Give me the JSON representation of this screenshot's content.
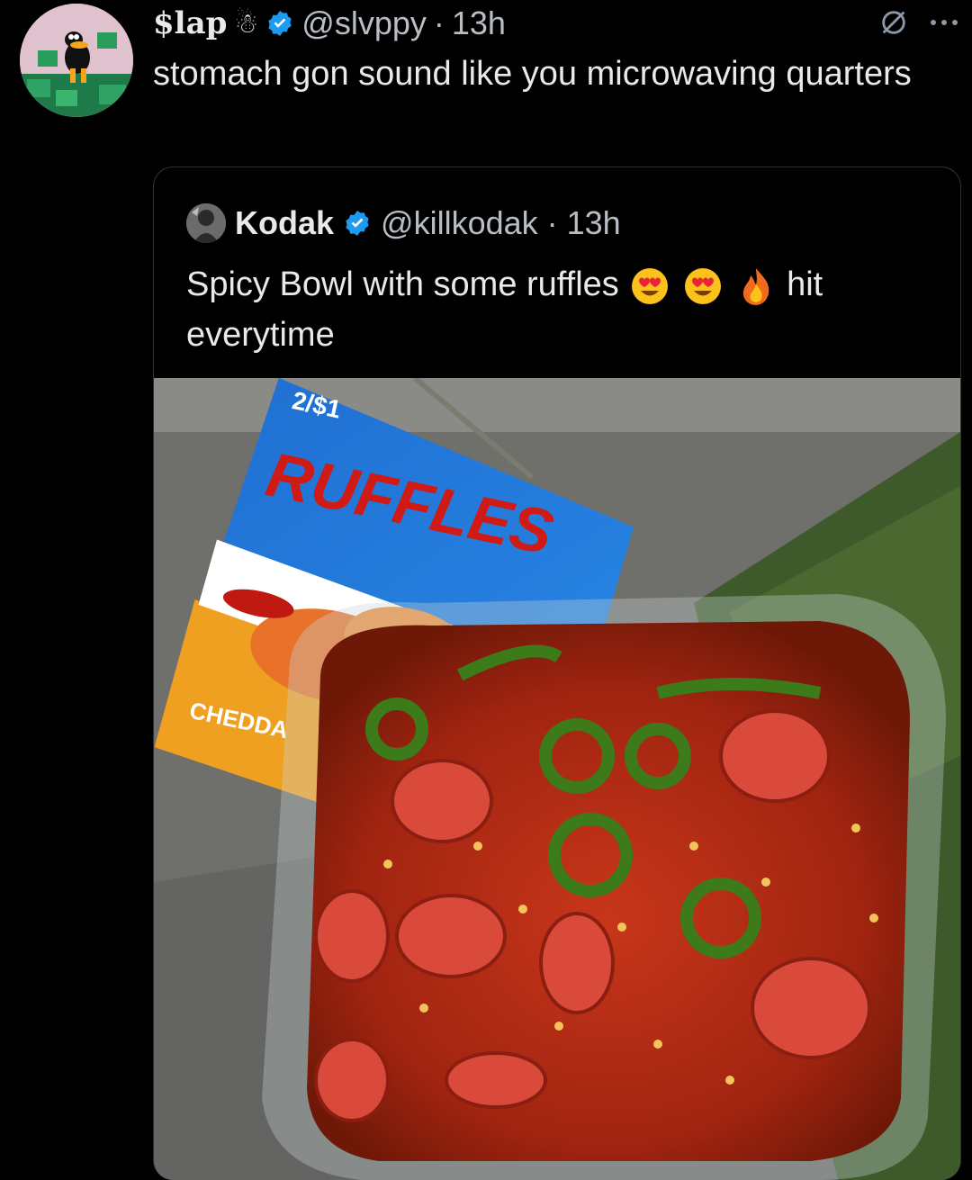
{
  "tweet": {
    "display_name": "$lap",
    "snowman_emoji": "☃",
    "handle": "@slvppy",
    "separator": "·",
    "time": "13h",
    "text": "stomach gon sound like you microwaving quarters",
    "icons": [
      "verified-badge-icon",
      "grok-icon",
      "more-icon"
    ]
  },
  "quoted": {
    "display_name": "Kodak",
    "handle": "@killkodak",
    "separator": "·",
    "time": "13h",
    "text_before": "Spicy Bowl with some ruffles",
    "text_after": "hit everytime",
    "emojis": [
      "heart-eyes",
      "heart-eyes",
      "fire"
    ]
  },
  "photo": {
    "bag_price": "2/$1",
    "bag_brand": "RUFFLES",
    "bag_flavor": "CHEDDA"
  },
  "colors": {
    "background": "#000000",
    "text": "#e7e9ea",
    "muted": "#b8bec4",
    "verified": "#1d9bf0"
  }
}
